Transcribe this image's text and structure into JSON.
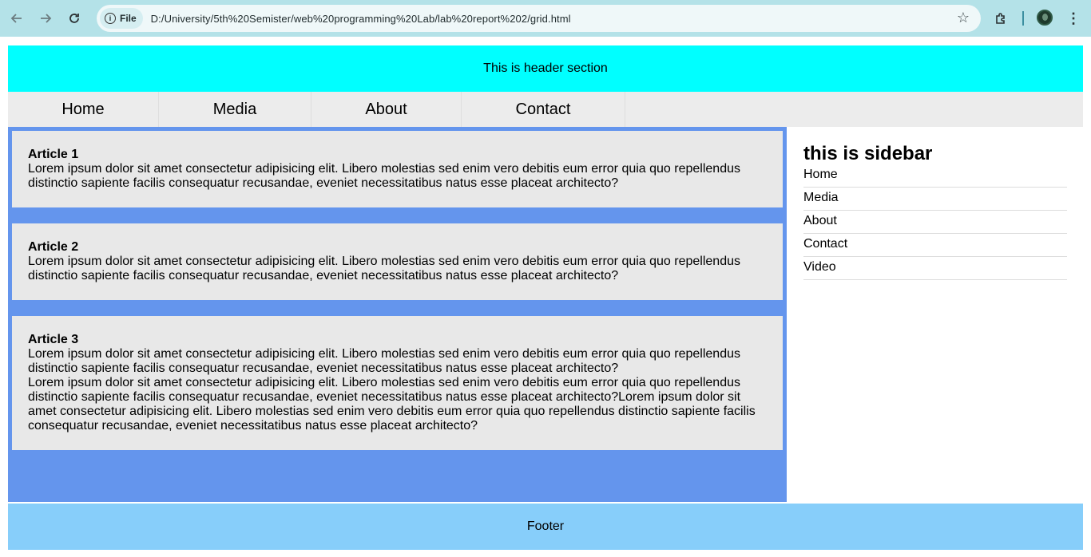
{
  "browser": {
    "chip_label": "File",
    "url": "D:/University/5th%20Semister/web%20programming%20Lab/lab%20report%202/grid.html"
  },
  "header": {
    "text": "This is header section"
  },
  "nav": {
    "items": [
      {
        "label": "Home"
      },
      {
        "label": "Media"
      },
      {
        "label": "About"
      },
      {
        "label": "Contact"
      }
    ]
  },
  "articles": [
    {
      "title": "Article 1",
      "paragraphs": [
        "Lorem ipsum dolor sit amet consectetur adipisicing elit. Libero molestias sed enim vero debitis eum error quia quo repellendus distinctio sapiente facilis consequatur recusandae, eveniet necessitatibus natus esse placeat architecto?"
      ]
    },
    {
      "title": "Article 2",
      "paragraphs": [
        "Lorem ipsum dolor sit amet consectetur adipisicing elit. Libero molestias sed enim vero debitis eum error quia quo repellendus distinctio sapiente facilis consequatur recusandae, eveniet necessitatibus natus esse placeat architecto?"
      ]
    },
    {
      "title": "Article 3",
      "paragraphs": [
        "Lorem ipsum dolor sit amet consectetur adipisicing elit. Libero molestias sed enim vero debitis eum error quia quo repellendus distinctio sapiente facilis consequatur recusandae, eveniet necessitatibus natus esse placeat architecto?",
        "Lorem ipsum dolor sit amet consectetur adipisicing elit. Libero molestias sed enim vero debitis eum error quia quo repellendus distinctio sapiente facilis consequatur recusandae, eveniet necessitatibus natus esse placeat architecto?Lorem ipsum dolor sit amet consectetur adipisicing elit. Libero molestias sed enim vero debitis eum error quia quo repellendus distinctio sapiente facilis consequatur recusandae, eveniet necessitatibus natus esse placeat architecto?"
      ]
    }
  ],
  "sidebar": {
    "title": "this is sidebar",
    "links": [
      {
        "label": "Home"
      },
      {
        "label": "Media"
      },
      {
        "label": "About"
      },
      {
        "label": "Contact"
      },
      {
        "label": "Video"
      }
    ]
  },
  "footer": {
    "text": "Footer"
  },
  "colors": {
    "header_bg": "#00ffff",
    "nav_bg": "#ececec",
    "articles_bg": "#6495ed",
    "article_bg": "#e8e8e8",
    "footer_bg": "#87cefa",
    "browser_bar_bg": "#b4e2e8"
  },
  "icons": {
    "back": "arrow-left-icon",
    "forward": "arrow-right-icon",
    "reload": "reload-icon",
    "info": "info-icon",
    "bookmark": "star-icon",
    "extensions": "puzzle-icon",
    "profile": "avatar",
    "menu": "kebab-menu-icon"
  }
}
